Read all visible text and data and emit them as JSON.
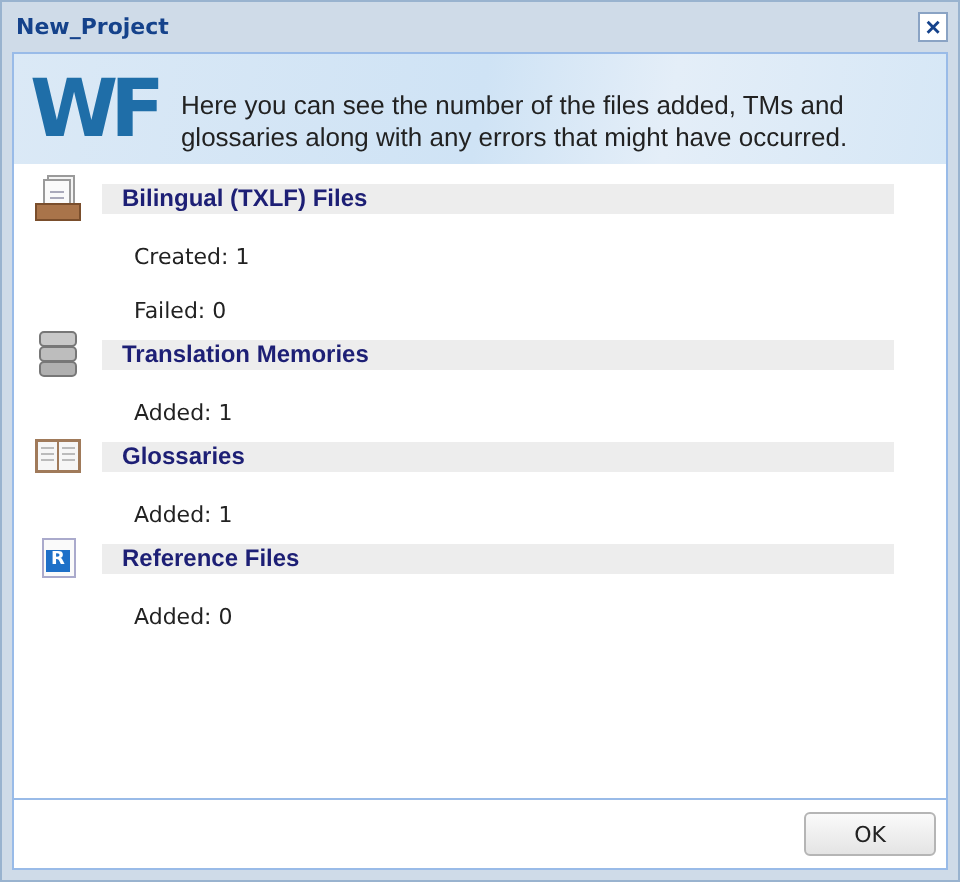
{
  "window": {
    "title": "New_Project",
    "close": "×"
  },
  "banner": {
    "logo": "WF",
    "message": "Here you can see the number of the files added, TMs and glossaries along with any errors that might have occurred."
  },
  "sections": [
    {
      "kind": "files",
      "title": "Bilingual (TXLF) Files",
      "items": [
        "Created: 1",
        "Failed: 0"
      ]
    },
    {
      "kind": "memory",
      "title": "Translation Memories",
      "items": [
        "Added: 1"
      ]
    },
    {
      "kind": "glossary",
      "title": "Glossaries",
      "items": [
        "Added: 1"
      ]
    },
    {
      "kind": "reference",
      "icon_text": "R",
      "title": "Reference Files",
      "items": [
        "Added: 0"
      ]
    }
  ],
  "buttons": [
    "OK"
  ]
}
